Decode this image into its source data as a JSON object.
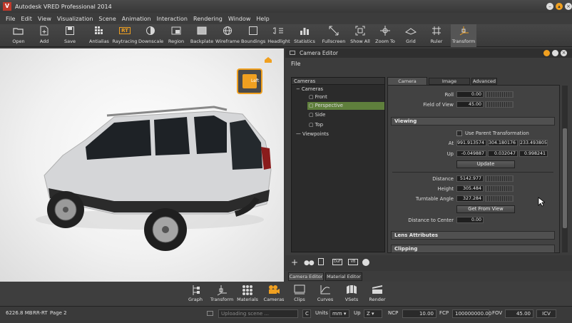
{
  "window": {
    "title": "Autodesk VRED Professional 2014"
  },
  "menu": [
    "File",
    "Edit",
    "View",
    "Visualization",
    "Scene",
    "Animation",
    "Interaction",
    "Rendering",
    "Window",
    "Help"
  ],
  "toolbar": [
    {
      "label": "Open",
      "icon": "folder-icon"
    },
    {
      "label": "Add",
      "icon": "add-file-icon"
    },
    {
      "label": "Save",
      "icon": "save-icon"
    },
    {
      "label": "Antialias",
      "icon": "antialias-icon"
    },
    {
      "label": "Raytracing",
      "icon": "raytracing-icon"
    },
    {
      "label": "Downscale",
      "icon": "downscale-icon"
    },
    {
      "label": "Region",
      "icon": "region-icon"
    },
    {
      "label": "Backplate",
      "icon": "backplate-icon"
    },
    {
      "label": "Wireframe",
      "icon": "wireframe-icon"
    },
    {
      "label": "Boundings",
      "icon": "boundings-icon"
    },
    {
      "label": "Headlight",
      "icon": "headlight-icon"
    },
    {
      "label": "Statistics",
      "icon": "statistics-icon"
    },
    {
      "label": "Fullscreen",
      "icon": "fullscreen-icon"
    },
    {
      "label": "Show All",
      "icon": "show-all-icon"
    },
    {
      "label": "Zoom To",
      "icon": "zoom-to-icon"
    },
    {
      "label": "Grid",
      "icon": "grid-icon"
    },
    {
      "label": "Ruler",
      "icon": "ruler-icon"
    },
    {
      "label": "Transform",
      "icon": "transform-icon"
    }
  ],
  "raytracing_badge": "RT",
  "viewcube": {
    "face": "Left"
  },
  "camera_editor": {
    "title": "Camera Editor",
    "file_menu": "File",
    "tree_header": "Cameras",
    "tree": [
      {
        "label": "Cameras"
      },
      {
        "label": "Front"
      },
      {
        "label": "Perspective",
        "selected": true
      },
      {
        "label": "Side"
      },
      {
        "label": "Top"
      },
      {
        "label": "Viewpoints"
      }
    ],
    "tabs": [
      "Camera Settings",
      "Image Processing",
      "Advanced"
    ],
    "active_tab": "Camera Settings",
    "roll_label": "Roll",
    "roll": "0.00",
    "fov_label": "Field of View",
    "fov": "45.00",
    "viewing_label": "Viewing",
    "use_parent_label": "Use Parent Transformation",
    "at_label": "At",
    "at": [
      "991.913574",
      "304.180176",
      "233.493805"
    ],
    "up_label": "Up",
    "up": [
      "-0.049887",
      "0.032047",
      "0.998241"
    ],
    "update_label": "Update",
    "distance_label": "Distance",
    "distance": "5142.977",
    "height_label": "Height",
    "height": "305.484",
    "turntable_label": "Turntable Angle",
    "turntable": "327.284",
    "get_from_view_label": "Get From View",
    "dist_center_label": "Distance to Center",
    "dist_center": "0.00",
    "lens_label": "Lens Attributes",
    "clipping_label": "Clipping",
    "bottom_tabs": [
      "Camera Editor",
      "Material Editor"
    ],
    "active_bottom_tab": "Camera Editor"
  },
  "bottom_buttons": [
    {
      "label": "Graph",
      "icon": "graph-icon"
    },
    {
      "label": "Transform",
      "icon": "transform-icon"
    },
    {
      "label": "Materials",
      "icon": "materials-icon"
    },
    {
      "label": "Cameras",
      "icon": "cameras-icon"
    },
    {
      "label": "Clips",
      "icon": "clips-icon"
    },
    {
      "label": "Curves",
      "icon": "curves-icon"
    },
    {
      "label": "VSets",
      "icon": "vsets-icon"
    },
    {
      "label": "Render",
      "icon": "render-icon"
    }
  ],
  "status": {
    "memory": "6226.8 MB",
    "mode": "RR-RT",
    "page": "Page 2",
    "uploading": "Uploading scene ...",
    "c_label": "C",
    "units_label": "Units",
    "units": "mm",
    "up_label": "Up",
    "up": "Z",
    "ncp_label": "NCP",
    "ncp": "10.00",
    "fcp_label": "FCP",
    "fcp": "100000000.00",
    "fov_label": "FOV",
    "fov": "45.00",
    "icv": "ICV"
  },
  "colors": {
    "accent": "#f0a020",
    "selected": "#5f7f3c",
    "background": "#3a3a3a"
  }
}
